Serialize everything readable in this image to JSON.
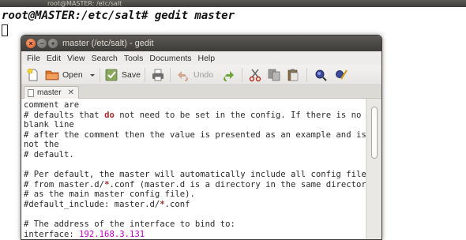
{
  "terminal": {
    "title": "root@MASTER: /etc/salt",
    "prompt": "root@MASTER:/etc/salt# gedit master"
  },
  "gedit": {
    "title": "master (/etc/salt) - gedit",
    "menu": [
      "File",
      "Edit",
      "View",
      "Search",
      "Tools",
      "Documents",
      "Help"
    ],
    "toolbar": {
      "open_label": "Open",
      "save_label": "Save",
      "undo_label": "Undo"
    },
    "tab": {
      "label": "master",
      "close": "✕"
    },
    "code": {
      "l1": "comment are",
      "l2a": "# defaults that ",
      "l2b": "do",
      "l2c": " not need to be set in the config. If there is no",
      "l3": "blank line",
      "l4": "# after the comment then the value is presented as an example and is",
      "l5": "not the",
      "l6": "# default.",
      "l7": "",
      "l8": "# Per default, the master will automatically include all config files",
      "l9a": "# from master.d/",
      "l9b": "*",
      "l9c": ".conf (master.d is a directory in the same directory",
      "l10": "# as the main master config file).",
      "l11a": "#default_include: master.d/",
      "l11b": "*",
      "l11c": ".conf",
      "l12": "",
      "l13": "# The address of the interface to bind to:",
      "l14a": "interface: ",
      "l14b": "192.168.3.131"
    }
  }
}
